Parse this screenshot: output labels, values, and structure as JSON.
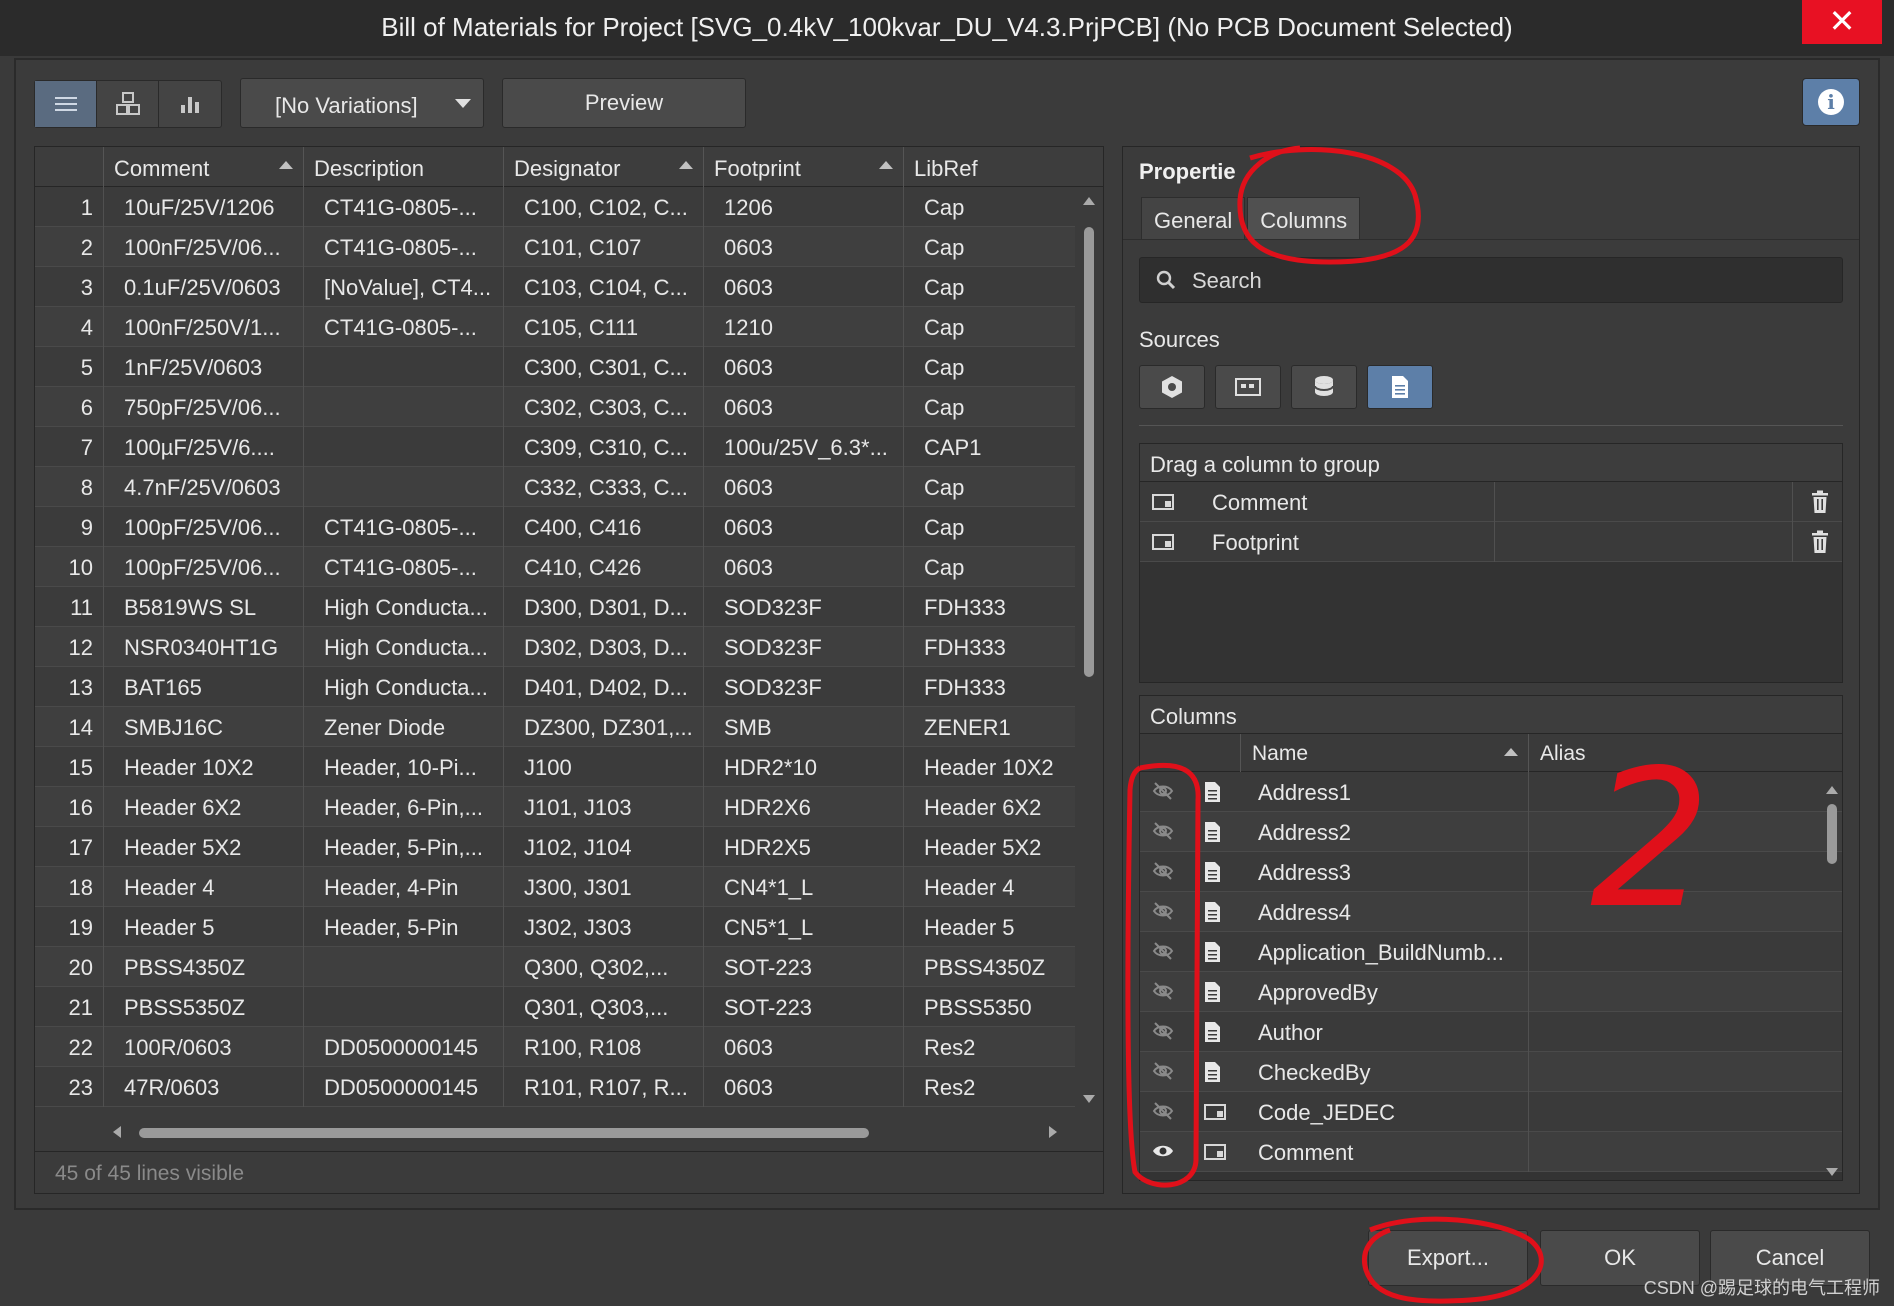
{
  "window": {
    "title": "Bill of Materials for Project [SVG_0.4kV_100kvar_DU_V4.3.PrjPCB] (No PCB Document Selected)",
    "close_glyph": "✕"
  },
  "toolbar": {
    "variations": "[No Variations]",
    "preview": "Preview",
    "info_glyph": "i"
  },
  "grid": {
    "columns": [
      "Comment",
      "Description",
      "Designator",
      "Footprint",
      "LibRef"
    ],
    "rows": [
      [
        "1",
        "10uF/25V/1206",
        "CT41G-0805-...",
        "C100, C102, C...",
        "1206",
        "Cap"
      ],
      [
        "2",
        "100nF/25V/06...",
        "CT41G-0805-...",
        "C101, C107",
        "0603",
        "Cap"
      ],
      [
        "3",
        "0.1uF/25V/0603",
        "[NoValue], CT4...",
        "C103, C104, C...",
        "0603",
        "Cap"
      ],
      [
        "4",
        "100nF/250V/1...",
        "CT41G-0805-...",
        "C105, C111",
        "1210",
        "Cap"
      ],
      [
        "5",
        "1nF/25V/0603",
        "",
        "C300, C301, C...",
        "0603",
        "Cap"
      ],
      [
        "6",
        "750pF/25V/06...",
        "",
        "C302, C303, C...",
        "0603",
        "Cap"
      ],
      [
        "7",
        "100µF/25V/6....",
        "",
        "C309, C310, C...",
        "100u/25V_6.3*...",
        "CAP1"
      ],
      [
        "8",
        "4.7nF/25V/0603",
        "",
        "C332, C333, C...",
        "0603",
        "Cap"
      ],
      [
        "9",
        "100pF/25V/06...",
        "CT41G-0805-...",
        "C400, C416",
        "0603",
        "Cap"
      ],
      [
        "10",
        "100pF/25V/06...",
        "CT41G-0805-...",
        "C410, C426",
        "0603",
        "Cap"
      ],
      [
        "11",
        "B5819WS SL",
        "High Conducta...",
        "D300, D301, D...",
        "SOD323F",
        "FDH333"
      ],
      [
        "12",
        "NSR0340HT1G",
        "High Conducta...",
        "D302, D303, D...",
        "SOD323F",
        "FDH333"
      ],
      [
        "13",
        "BAT165",
        "High Conducta...",
        "D401, D402, D...",
        "SOD323F",
        "FDH333"
      ],
      [
        "14",
        "SMBJ16C",
        "Zener Diode",
        "DZ300, DZ301,...",
        "SMB",
        "ZENER1"
      ],
      [
        "15",
        "Header 10X2",
        "Header, 10-Pi...",
        "J100",
        "HDR2*10",
        "Header 10X2"
      ],
      [
        "16",
        "Header 6X2",
        "Header, 6-Pin,...",
        "J101, J103",
        "HDR2X6",
        "Header 6X2"
      ],
      [
        "17",
        "Header 5X2",
        "Header, 5-Pin,...",
        "J102, J104",
        "HDR2X5",
        "Header 5X2"
      ],
      [
        "18",
        "Header 4",
        "Header, 4-Pin",
        "J300, J301",
        "CN4*1_L",
        "Header 4"
      ],
      [
        "19",
        "Header 5",
        "Header, 5-Pin",
        "J302, J303",
        "CN5*1_L",
        "Header 5"
      ],
      [
        "20",
        "PBSS4350Z",
        "",
        "Q300, Q302,...",
        "SOT-223",
        "PBSS4350Z"
      ],
      [
        "21",
        "PBSS5350Z",
        "",
        "Q301, Q303,...",
        "SOT-223",
        "PBSS5350"
      ],
      [
        "22",
        "100R/0603",
        "DD0500000145",
        "R100, R108",
        "0603",
        "Res2"
      ],
      [
        "23",
        "47R/0603",
        "DD0500000145",
        "R101, R107, R...",
        "0603",
        "Res2"
      ]
    ],
    "footer": "45 of 45 lines visible"
  },
  "properties": {
    "title": "Propertie",
    "tabs": [
      "General",
      "Columns"
    ],
    "search_placeholder": "Search",
    "sources_label": "Sources",
    "group_header": "Drag a column to group",
    "group_items": [
      "Comment",
      "Footprint"
    ],
    "columns_header": "Columns",
    "columns_table_headers": [
      "Name",
      "Alias"
    ],
    "columns_items": [
      {
        "name": "Address1",
        "visible": false,
        "type": "document-icon"
      },
      {
        "name": "Address2",
        "visible": false,
        "type": "document-icon"
      },
      {
        "name": "Address3",
        "visible": false,
        "type": "document-icon"
      },
      {
        "name": "Address4",
        "visible": false,
        "type": "document-icon"
      },
      {
        "name": "Application_BuildNumb...",
        "visible": false,
        "type": "document-icon"
      },
      {
        "name": "ApprovedBy",
        "visible": false,
        "type": "document-icon"
      },
      {
        "name": "Author",
        "visible": false,
        "type": "document-icon"
      },
      {
        "name": "CheckedBy",
        "visible": false,
        "type": "document-icon"
      },
      {
        "name": "Code_JEDEC",
        "visible": false,
        "type": "component-icon"
      },
      {
        "name": "Comment",
        "visible": true,
        "type": "component-icon"
      }
    ]
  },
  "buttons": {
    "export": "Export...",
    "ok": "OK",
    "cancel": "Cancel"
  },
  "annotation": {
    "number": "2",
    "color": "#e0101a"
  },
  "watermark": "CSDN @踢足球的电气工程师"
}
